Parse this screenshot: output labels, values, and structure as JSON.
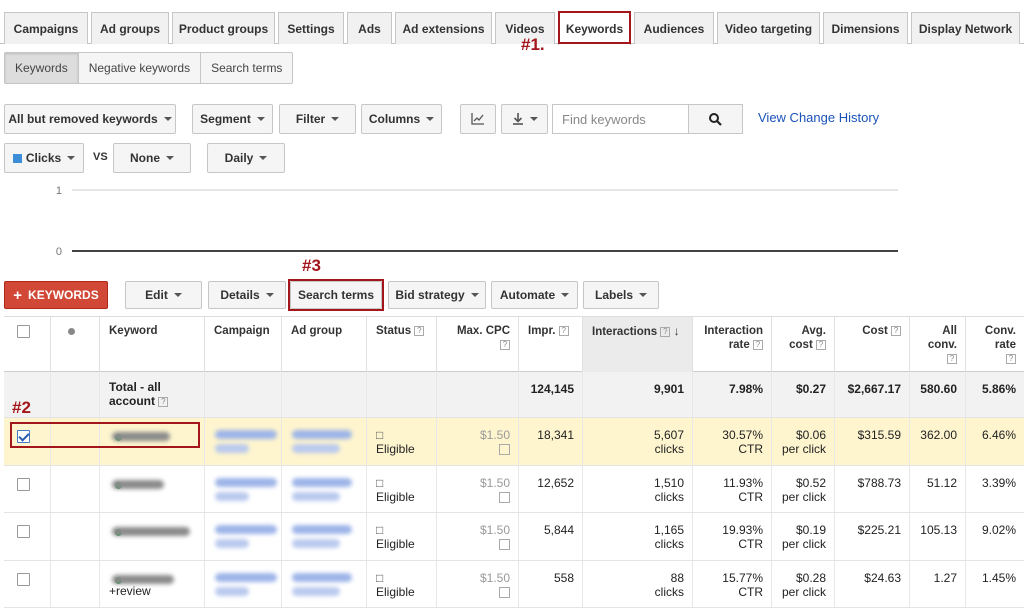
{
  "tabs": [
    "Campaigns",
    "Ad groups",
    "Product groups",
    "Settings",
    "Ads",
    "Ad extensions",
    "Videos",
    "Keywords",
    "Audiences",
    "Video targeting",
    "Dimensions",
    "Display Network"
  ],
  "subtabs": [
    "Keywords",
    "Negative keywords",
    "Search terms"
  ],
  "toolbar": {
    "filter_view": "All but removed keywords",
    "segment": "Segment",
    "filter": "Filter",
    "columns": "Columns",
    "search_placeholder": "Find keywords",
    "view_change_history": "View Change History"
  },
  "chart_controls": {
    "metric": "Clicks",
    "vs": "VS",
    "compare": "None",
    "period": "Daily",
    "metric_color": "#3c8ed8"
  },
  "chart_data": {
    "type": "line",
    "x": [],
    "series": [],
    "yticks": [
      "1",
      "0"
    ],
    "ylim": [
      0,
      1
    ]
  },
  "actions": {
    "add_keywords": "KEYWORDS",
    "edit": "Edit",
    "details": "Details",
    "search_terms": "Search terms",
    "bid_strategy": "Bid strategy",
    "automate": "Automate",
    "labels": "Labels"
  },
  "annotations": {
    "one": "#1.",
    "two": "#2",
    "three": "#3",
    "color": "#a3171c"
  },
  "columns": {
    "keyword": "Keyword",
    "campaign": "Campaign",
    "ad_group": "Ad group",
    "status": "Status",
    "max_cpc": "Max. CPC",
    "impr": "Impr.",
    "interactions": "Interactions",
    "interaction_rate": [
      "Interaction",
      "rate"
    ],
    "avg_cost": [
      "Avg.",
      "cost"
    ],
    "cost": "Cost",
    "all_conv": [
      "All",
      "conv."
    ],
    "conv_rate": [
      "Conv.",
      "rate"
    ]
  },
  "total_row": {
    "label": [
      "Total - all",
      "account"
    ],
    "impr": "124,145",
    "interactions": "9,901",
    "interaction_rate": "7.98%",
    "avg_cost": "$0.27",
    "cost": "$2,667.17",
    "all_conv": "580.60",
    "conv_rate": "5.86%"
  },
  "rows": [
    {
      "keyword_extra": "",
      "status": "Eligible",
      "max_cpc": "$1.50",
      "impr": "18,341",
      "interactions": "5,607",
      "interactions_unit": "clicks",
      "interaction_rate": "30.57%",
      "rate_unit": "CTR",
      "avg_cost": "$0.06",
      "cost_unit": "per click",
      "cost": "$315.59",
      "all_conv": "362.00",
      "conv_rate": "6.46%",
      "selected": true
    },
    {
      "keyword_extra": "",
      "status": "Eligible",
      "max_cpc": "$1.50",
      "impr": "12,652",
      "interactions": "1,510",
      "interactions_unit": "clicks",
      "interaction_rate": "11.93%",
      "rate_unit": "CTR",
      "avg_cost": "$0.52",
      "cost_unit": "per click",
      "cost": "$788.73",
      "all_conv": "51.12",
      "conv_rate": "3.39%",
      "selected": false
    },
    {
      "keyword_extra": "",
      "status": "Eligible",
      "max_cpc": "$1.50",
      "impr": "5,844",
      "interactions": "1,165",
      "interactions_unit": "clicks",
      "interaction_rate": "19.93%",
      "rate_unit": "CTR",
      "avg_cost": "$0.19",
      "cost_unit": "per click",
      "cost": "$225.21",
      "all_conv": "105.13",
      "conv_rate": "9.02%",
      "selected": false
    },
    {
      "keyword_extra": "+review",
      "status": "Eligible",
      "max_cpc": "$1.50",
      "impr": "558",
      "interactions": "88",
      "interactions_unit": "clicks",
      "interaction_rate": "15.77%",
      "rate_unit": "CTR",
      "avg_cost": "$0.28",
      "cost_unit": "per click",
      "cost": "$24.63",
      "all_conv": "1.27",
      "conv_rate": "1.45%",
      "selected": false
    }
  ]
}
